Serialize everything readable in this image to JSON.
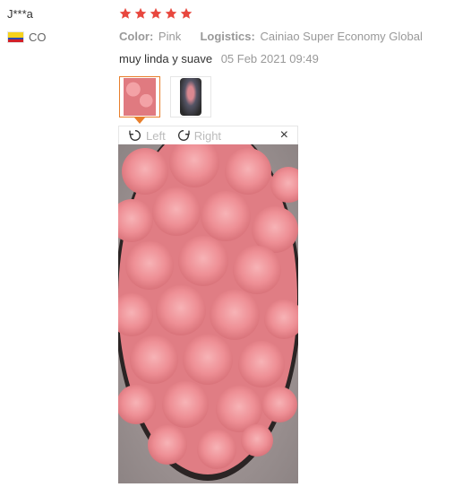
{
  "user": {
    "name": "J***a",
    "country": "CO"
  },
  "review": {
    "rating": 5,
    "max_rating": 5,
    "color_label": "Color:",
    "color_value": "Pink",
    "logistics_label": "Logistics:",
    "logistics_value": "Cainiao Super Economy Global",
    "comment": "muy linda y suave",
    "date": "05 Feb 2021 09:49"
  },
  "viewer": {
    "rotate_left_label": "Left",
    "rotate_right_label": "Right",
    "close_symbol": "×"
  },
  "colors": {
    "star": "#e8473e",
    "active_thumb": "#e87f2c",
    "muted_text": "#999999"
  },
  "icons": [
    "star-icon",
    "rotate-left-icon",
    "rotate-right-icon",
    "close-icon"
  ]
}
